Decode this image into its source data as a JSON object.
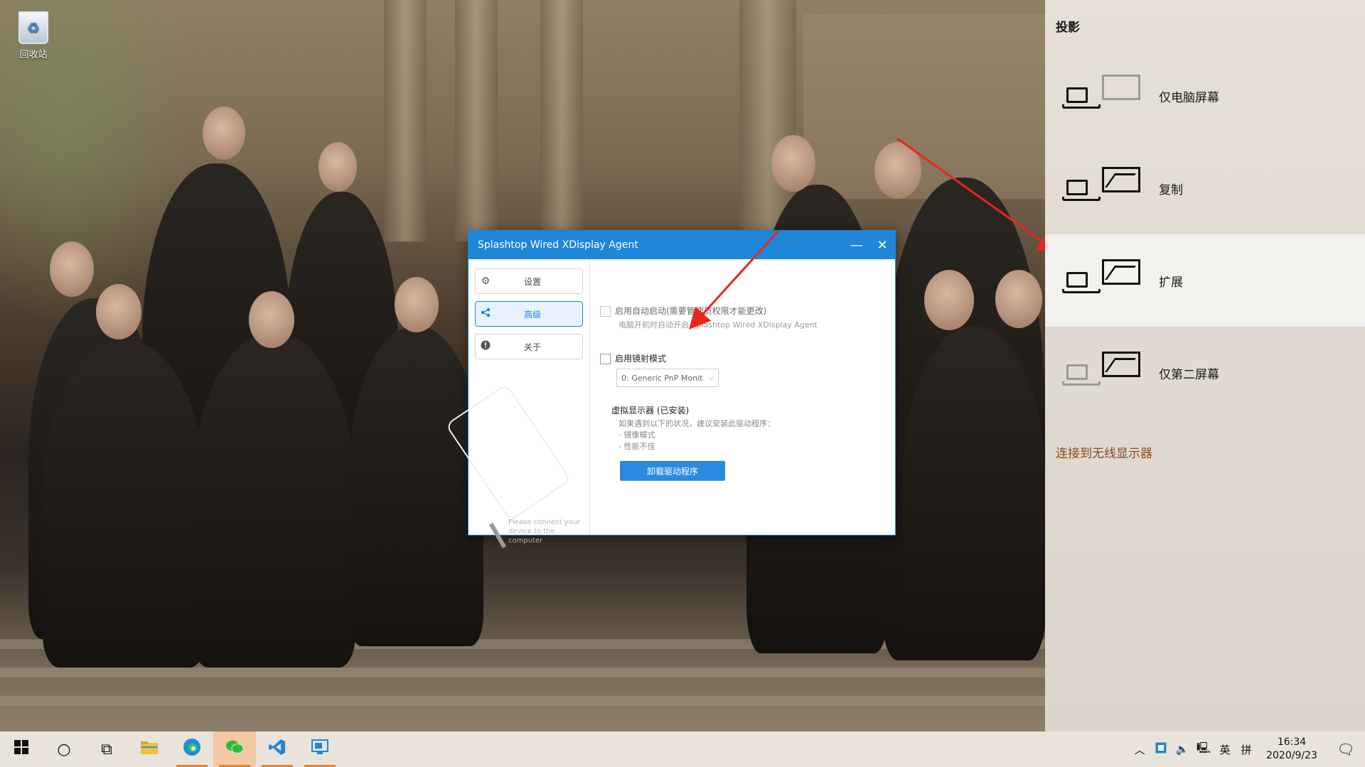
{
  "desktop": {
    "icons": [
      {
        "label": "回收站",
        "icon": "recycle-bin-icon"
      }
    ]
  },
  "window": {
    "title": "Splashtop Wired XDisplay Agent",
    "minimize_glyph": "—",
    "close_glyph": "✕",
    "nav": [
      {
        "label": "设置",
        "icon": "gear-icon",
        "active": false
      },
      {
        "label": "高级",
        "icon": "share-icon",
        "active": true
      },
      {
        "label": "关于",
        "icon": "info-icon",
        "active": false
      }
    ],
    "connect_hint": "Please connect your device to the computer",
    "autostart_label": "启用自动启动(需要管理员权限才能更改)",
    "autostart_sub": "电脑开机时自动开启 Splashtop Wired XDisplay Agent",
    "mirror_label": "启用镜射模式",
    "monitor_select_value": "0: Generic PnP Monit",
    "virtual_display_title": "虚拟显示器 (已安装)",
    "virtual_display_desc": [
      "如果遇到以下的状况，建议安装此驱动程序：",
      "- 镜像模式",
      "- 性能不佳"
    ],
    "uninstall_button": "卸载驱动程序"
  },
  "project_panel": {
    "title": "投影",
    "options": [
      {
        "label": "仅电脑屏幕",
        "icon": "pc-screen-only-icon",
        "selected": false
      },
      {
        "label": "复制",
        "icon": "duplicate-icon",
        "selected": false
      },
      {
        "label": "扩展",
        "icon": "extend-icon",
        "selected": true
      },
      {
        "label": "仅第二屏幕",
        "icon": "second-screen-only-icon",
        "selected": false
      }
    ],
    "wireless_link": "连接到无线显示器"
  },
  "taskbar": {
    "tray": {
      "language": "英",
      "ime": "拼",
      "time": "16:34",
      "date": "2020/9/23"
    }
  },
  "colors": {
    "accent": "#1f86d8",
    "arrow": "#e8261c",
    "link": "#8a4a1a"
  }
}
